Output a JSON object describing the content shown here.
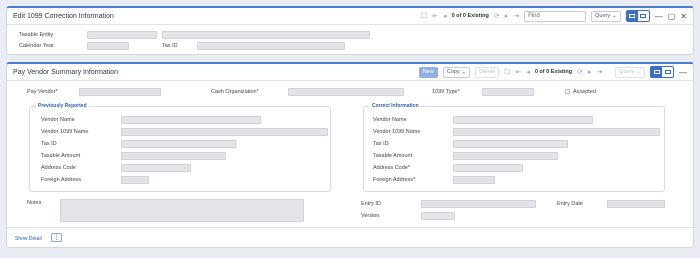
{
  "correction_panel": {
    "title": "Edit 1099 Correction Information",
    "record_count": "0 of 0 Existing",
    "find_placeholder": "Find",
    "query_label": "Query",
    "fields": {
      "taxable_entity_label": "Taxable Entity",
      "calendar_year_label": "Calendar Year",
      "tax_id_label": "Tax ID"
    }
  },
  "summary_panel": {
    "title": "Pay Vendor Summary Information",
    "new_label": "New",
    "copy_label": "Copy",
    "delete_label": "Delete",
    "record_count": "0 of 0 Existing",
    "query_label": "Query",
    "top_fields": {
      "pay_vendor_label": "Pay Vendor",
      "cash_org_label": "Cash Organization",
      "type_1099_label": "1099 Type",
      "accepted_label": "Accepted"
    },
    "previously_reported": {
      "title": "Previously Reported",
      "rows": [
        "Vendor Name",
        "Vendor 1099 Name",
        "Tax ID",
        "Taxable Amount",
        "Address Code",
        "Foreign Address"
      ]
    },
    "correct_information": {
      "title": "Correct Information",
      "rows": [
        "Vendor Name",
        "Vendor 1099 Name",
        "Tax ID",
        "Taxable Amount",
        "Address Code",
        "Foreign Address"
      ]
    },
    "notes_label": "Notes",
    "entry_id_label": "Entry ID",
    "entry_date_label": "Entry Date",
    "version_label": "Version",
    "show_detail": "Show Detail"
  }
}
